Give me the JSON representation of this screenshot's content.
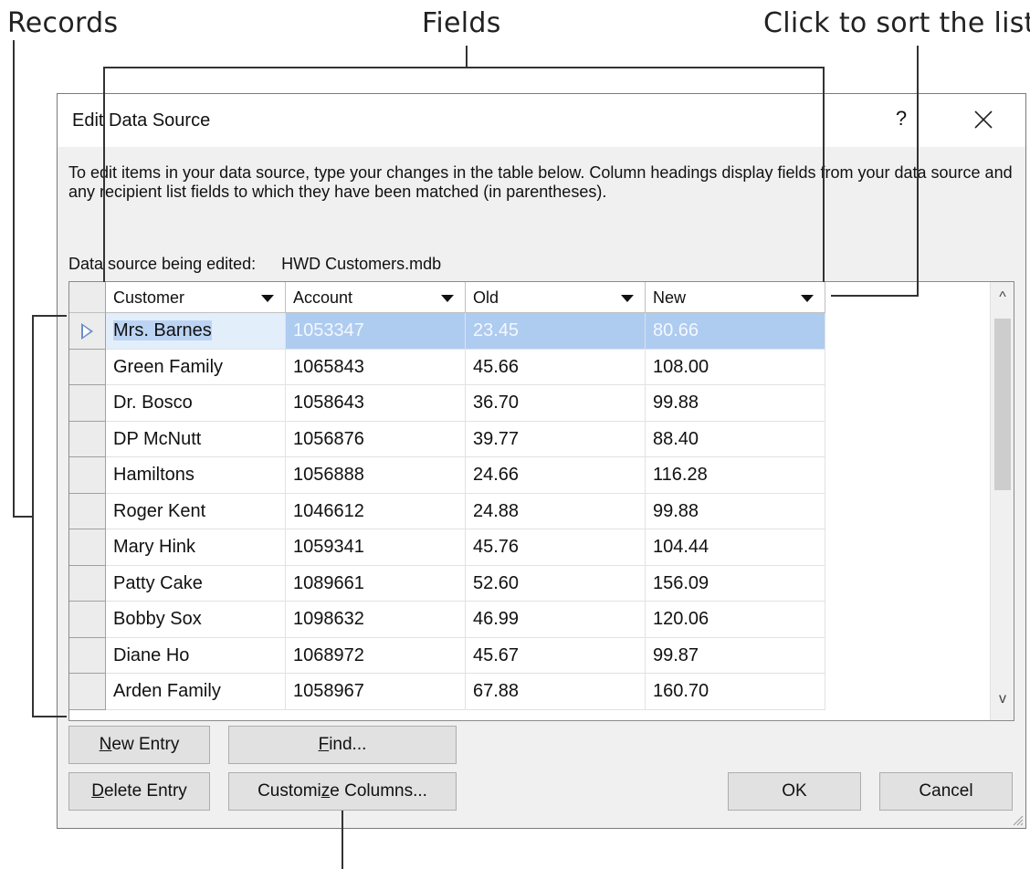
{
  "callouts": {
    "records": "Records",
    "fields": "Fields",
    "sort": "Click to sort the list"
  },
  "dialog": {
    "title": "Edit Data Source",
    "help_label": "?",
    "close_icon": "close-icon",
    "instructions": "To edit items in your data source, type your changes in the table below. Column headings display fields from your data source and any recipient list fields to which they have been matched (in parentheses).",
    "source_label": "Data source being edited:",
    "source_file": "HWD Customers.mdb"
  },
  "grid": {
    "columns": [
      "Customer",
      "Account",
      "Old",
      "New"
    ],
    "selected_row": 0,
    "rows": [
      [
        "Mrs. Barnes",
        "1053347",
        "23.45",
        "80.66"
      ],
      [
        "Green Family",
        "1065843",
        "45.66",
        "108.00"
      ],
      [
        "Dr. Bosco",
        "1058643",
        "36.70",
        "99.88"
      ],
      [
        "DP McNutt",
        "1056876",
        "39.77",
        "88.40"
      ],
      [
        "Hamiltons",
        "1056888",
        "24.66",
        "116.28"
      ],
      [
        "Roger Kent",
        "1046612",
        "24.88",
        "99.88"
      ],
      [
        "Mary Hink",
        "1059341",
        "45.76",
        "104.44"
      ],
      [
        "Patty Cake",
        "1089661",
        "52.60",
        "156.09"
      ],
      [
        "Bobby Sox",
        "1098632",
        "46.99",
        "120.06"
      ],
      [
        "Diane Ho",
        "1068972",
        "45.67",
        "99.87"
      ],
      [
        "Arden Family",
        "1058967",
        "67.88",
        "160.70"
      ]
    ]
  },
  "buttons": {
    "new_entry": {
      "pre": "",
      "key": "N",
      "post": "ew Entry"
    },
    "find": {
      "pre": "",
      "key": "F",
      "post": "ind..."
    },
    "delete_entry": {
      "pre": "",
      "key": "D",
      "post": "elete Entry"
    },
    "customize": {
      "pre": "Customi",
      "key": "z",
      "post": "e Columns..."
    },
    "ok": "OK",
    "cancel": "Cancel"
  },
  "scrollbar": {
    "up": "^",
    "down": "v"
  }
}
